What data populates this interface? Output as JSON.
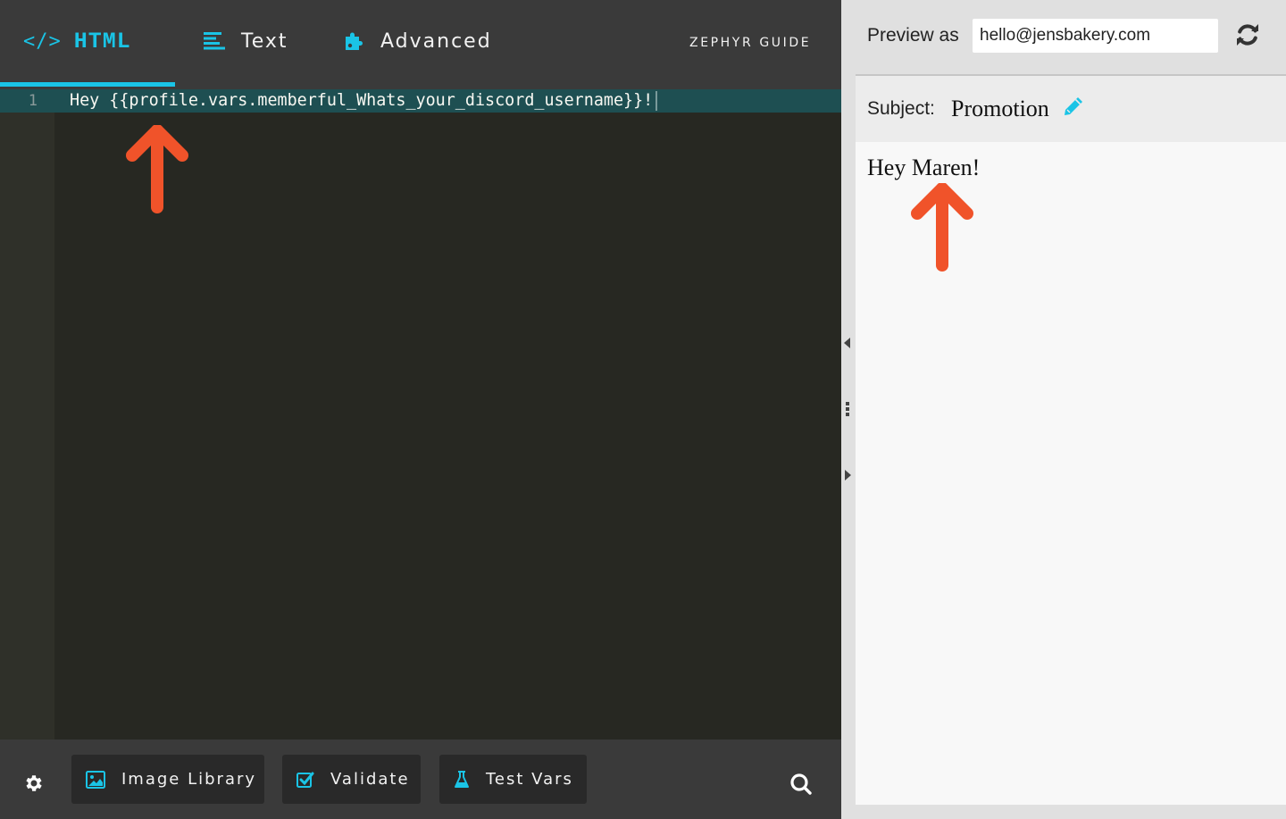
{
  "editor": {
    "tabs": [
      {
        "label": "HTML",
        "icon": "code-icon",
        "icon_text": "</>",
        "active": true
      },
      {
        "label": "Text",
        "icon": "align-left-icon",
        "active": false
      },
      {
        "label": "Advanced",
        "icon": "puzzle-icon",
        "active": false
      }
    ],
    "guide_link": "ZEPHYR GUIDE",
    "code": {
      "lines": [
        {
          "number": "1",
          "text": "Hey {{profile.vars.memberful_Whats_your_discord_username}}!"
        }
      ]
    },
    "toolbar": {
      "settings_icon": "gear-icon",
      "buttons": [
        {
          "label": "Image Library",
          "icon": "image-icon"
        },
        {
          "label": "Validate",
          "icon": "check-square-icon"
        },
        {
          "label": "Test Vars",
          "icon": "flask-icon"
        }
      ],
      "search_icon": "search-icon"
    }
  },
  "preview": {
    "preview_as_label": "Preview as",
    "preview_as_value": "hello@jensbakery.com",
    "subject_label": "Subject:",
    "subject_value": "Promotion",
    "body_text": "Hey Maren!"
  },
  "colors": {
    "accent": "#1ac4e6",
    "annotation_arrow": "#f0532a",
    "editor_bg": "#272822",
    "active_line": "#1e4f52"
  }
}
